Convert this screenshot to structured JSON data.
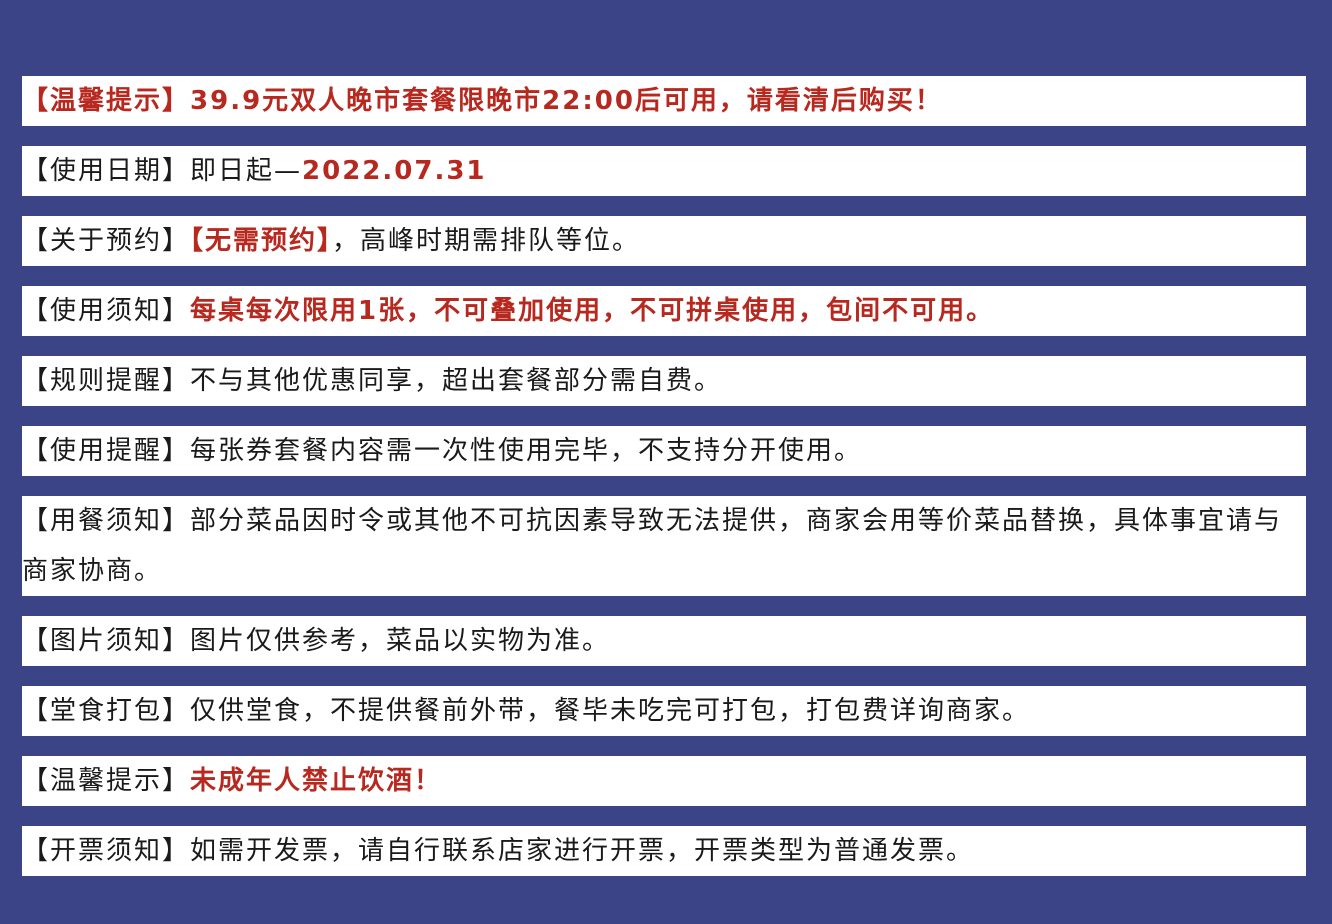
{
  "colors": {
    "background": "#3b4486",
    "panel": "#ffffff",
    "text": "#1a1a1a",
    "accent_red": "#b7281f"
  },
  "notices": [
    {
      "label": "【温馨提示】",
      "label_style": "red-bold",
      "text": "39.9元双人晚市套餐限晚市22:00后可用，请看清后购买！",
      "text_style": "red-bold"
    },
    {
      "label": "【使用日期】",
      "text": "即日起—",
      "highlight": "2022.07.31"
    },
    {
      "label": "【关于预约】",
      "highlight": "【无需预约】",
      "text": "，高峰时期需排队等位。"
    },
    {
      "label": "【使用须知】",
      "text": "每桌每次限用1张，不可叠加使用，不可拼桌使用，包间不可用。",
      "text_style": "red-bold"
    },
    {
      "label": "【规则提醒】",
      "text": "不与其他优惠同享，超出套餐部分需自费。"
    },
    {
      "label": "【使用提醒】",
      "text": "每张券套餐内容需一次性使用完毕，不支持分开使用。"
    },
    {
      "label": "【用餐须知】",
      "text": "部分菜品因时令或其他不可抗因素导致无法提供，商家会用等价菜品替换，具体事宜请与商家协商。"
    },
    {
      "label": "【图片须知】",
      "text": "图片仅供参考，菜品以实物为准。"
    },
    {
      "label": "【堂食打包】",
      "text": "仅供堂食，不提供餐前外带，餐毕未吃完可打包，打包费详询商家。"
    },
    {
      "label": "【温馨提示】",
      "text": "未成年人禁止饮酒！",
      "text_style": "red-bold"
    },
    {
      "label": "【开票须知】",
      "text": "如需开发票，请自行联系店家进行开票，开票类型为普通发票。"
    }
  ]
}
